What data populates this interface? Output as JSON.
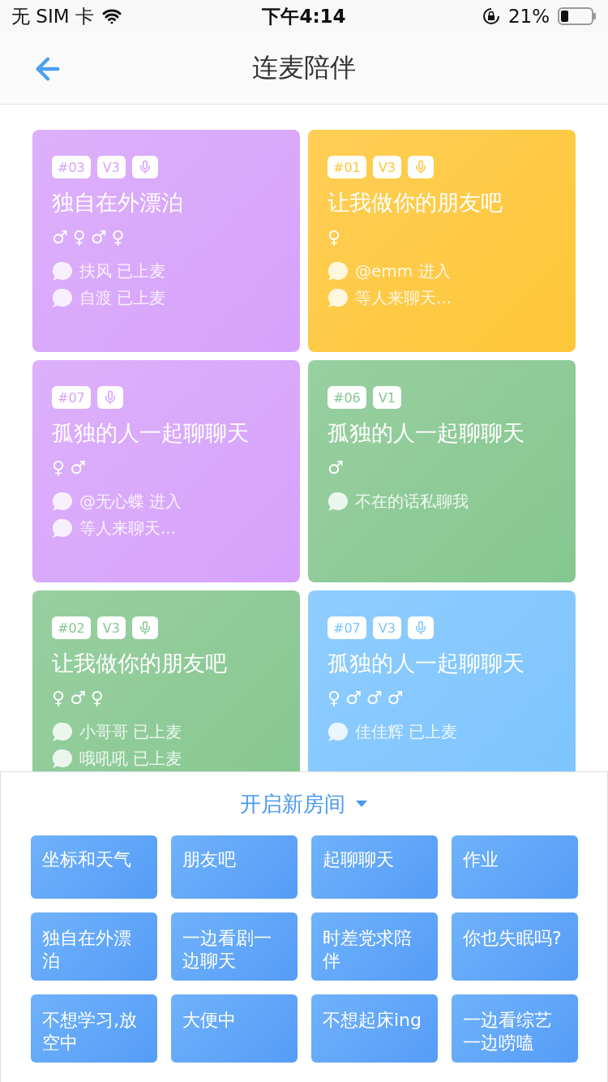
{
  "status_bar": {
    "carrier": "无 SIM 卡",
    "time": "下午4:14",
    "battery": "21%"
  },
  "nav": {
    "title": "连麦陪伴"
  },
  "rooms": [
    {
      "number": "#03",
      "tier": "V3",
      "mic": true,
      "title": "独自在外漂泊",
      "color": "#d6a2fa",
      "genders": [
        "♂",
        "♀",
        "♂",
        "♀"
      ],
      "messages": [
        "扶风 已上麦",
        "自渡 已上麦"
      ]
    },
    {
      "number": "#01",
      "tier": "V3",
      "mic": true,
      "title": "让我做你的朋友吧",
      "color": "#fec638",
      "genders": [
        "♀"
      ],
      "messages": [
        "@emm 进入",
        "等人来聊天..."
      ]
    },
    {
      "number": "#07",
      "mic": true,
      "title": "孤独的人一起聊聊天",
      "color": "#d6a2fa",
      "genders": [
        "♀",
        "♂"
      ],
      "messages": [
        "@无心蝶 进入",
        "等人来聊天..."
      ]
    },
    {
      "number": "#06",
      "tier": "V1",
      "mic": false,
      "title": "孤独的人一起聊聊天",
      "color": "#86c790",
      "genders": [
        "♂"
      ],
      "messages": [
        "不在的话私聊我"
      ]
    },
    {
      "number": "#02",
      "tier": "V3",
      "mic": true,
      "title": "让我做你的朋友吧",
      "color": "#86c790",
      "genders": [
        "♀",
        "♂",
        "♀"
      ],
      "messages": [
        "小哥哥 已上麦",
        "哦吼吼 已上麦"
      ]
    },
    {
      "number": "#07",
      "tier": "V3",
      "mic": true,
      "title": "孤独的人一起聊聊天",
      "color": "#7cc4fe",
      "genders": [
        "♀",
        "♂",
        "♂",
        "♂"
      ],
      "messages": [
        "佳佳辉 已上麦"
      ]
    }
  ],
  "new_room": {
    "title": "开启新房间",
    "expanded": true,
    "topics": [
      "坐标和天气",
      "朋友吧",
      "起聊聊天",
      "作业",
      "独自在外漂泊",
      "一边看剧一边聊天",
      "时差党求陪伴",
      "你也失眠吗?",
      "不想学习,放空中",
      "大便中",
      "不想起床ing",
      "一边看综艺一边唠嗑"
    ]
  }
}
